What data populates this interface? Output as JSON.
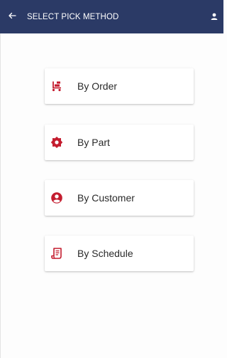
{
  "appbar": {
    "title": "SELECT PICK METHOD",
    "back_icon": "arrow-left-icon",
    "user_icon": "person-icon",
    "color": "#2b3a66"
  },
  "methods": [
    {
      "label": "By Order",
      "icon": "cart-icon"
    },
    {
      "label": "By Part",
      "icon": "gear-icon"
    },
    {
      "label": "By Customer",
      "icon": "account-circle-icon"
    },
    {
      "label": "By Schedule",
      "icon": "scroll-icon"
    }
  ],
  "colors": {
    "accent": "#c41d2f",
    "card_background": "#ffffff",
    "text": "#2a2a2a"
  }
}
